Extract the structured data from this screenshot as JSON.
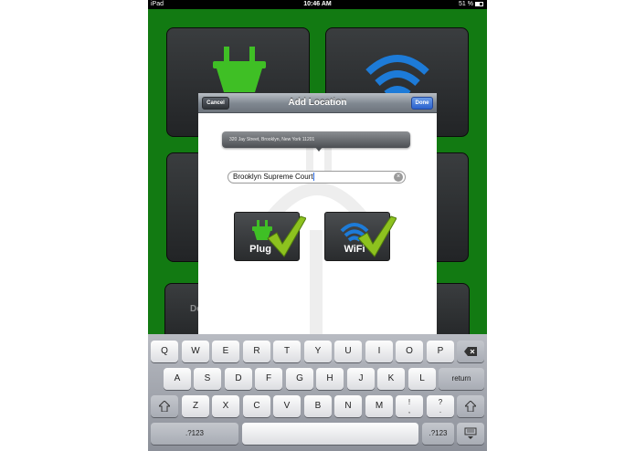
{
  "status_bar": {
    "carrier": "iPad",
    "time": "10:46 AM",
    "battery": "51 %"
  },
  "background": {
    "tile_partial_text": "De"
  },
  "modal": {
    "title": "Add Location",
    "cancel_label": "Cancel",
    "done_label": "Done",
    "address": "320 Jay Street, Brooklyn, New York 11201",
    "name_value": "Brooklyn Supreme Court",
    "types": [
      {
        "label": "Plug",
        "icon": "plug-icon",
        "selected": true
      },
      {
        "label": "WiFi",
        "icon": "wifi-icon",
        "selected": true
      }
    ]
  },
  "keyboard": {
    "row1": [
      "Q",
      "W",
      "E",
      "R",
      "T",
      "Y",
      "U",
      "I",
      "O",
      "P"
    ],
    "row2": [
      "A",
      "S",
      "D",
      "F",
      "G",
      "H",
      "J",
      "K",
      "L"
    ],
    "row3": [
      "Z",
      "X",
      "C",
      "V",
      "B",
      "N",
      "M"
    ],
    "return_label": "return",
    "numbers_label": ".?123",
    "exclaim_top": "!",
    "exclaim_bottom": ",",
    "question_top": "?",
    "question_bottom": "."
  },
  "colors": {
    "background_green": "#127a12",
    "plug_green": "#3fbf25",
    "wifi_blue": "#1d7bd8",
    "check_green": "#8dc21f",
    "done_blue": "#2c63cf"
  }
}
